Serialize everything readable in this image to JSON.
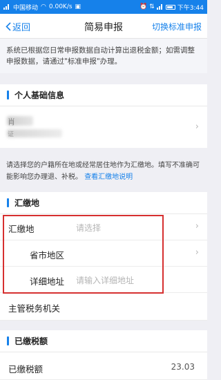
{
  "status_bar": {
    "carrier": "中国移动",
    "speed": "0.00K/s",
    "time": "下午3:44"
  },
  "header": {
    "back_label": "返回",
    "title": "简易申报",
    "switch_label": "切换标准申报"
  },
  "notice": {
    "text": "系统已根据您日常申报数据自动计算出退税金额；如需调整申报数据，请通过\"标准申报\"办理。"
  },
  "personal_info": {
    "title": "个人基础信息",
    "name_partial": "肖",
    "id_partial": "证"
  },
  "location_note": {
    "text": "请选择您的户籍所在地或经常居住地作为汇缴地。填写不准确可能影响您办理退、补税。",
    "link": "查看汇缴地说明"
  },
  "remit_section": {
    "title": "汇缴地",
    "remit_label": "汇缴地",
    "remit_placeholder": "请选择",
    "region_label": "省市地区",
    "address_label": "详细地址",
    "address_placeholder": "请输入详细地址",
    "tax_office_label": "主管税务机关"
  },
  "paid_section": {
    "title": "已缴税额",
    "paid_label": "已缴税额",
    "paid_value": "23.03"
  },
  "colors": {
    "accent": "#1681ea",
    "highlight_border": "#d62f2f",
    "background": "#efeff4"
  }
}
